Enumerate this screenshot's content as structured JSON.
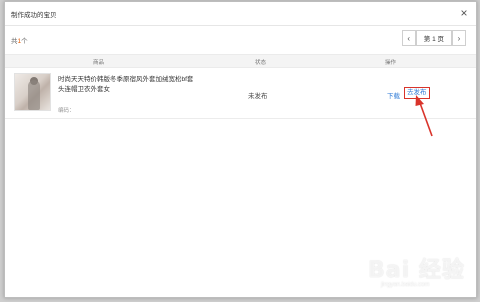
{
  "dialog": {
    "title": "制作成功的宝贝",
    "close_glyph": "×"
  },
  "summary": {
    "prefix": "共",
    "count": "1",
    "suffix": "个"
  },
  "pager": {
    "prev": "‹",
    "page_label": "第 1 页",
    "next": "›"
  },
  "table": {
    "columns": [
      "商品",
      "状态",
      "操作"
    ],
    "rows": [
      {
        "title": "时尚天天特价韩版冬季原宿风外套加绒宽松bf套头连帽卫衣外套女",
        "code_label": "编码：",
        "status": "未发布",
        "action_download": "下载",
        "action_publish": "去发布"
      }
    ]
  },
  "watermark": {
    "text": "Bai 经验",
    "sub": "jingyan.baidu.com"
  },
  "colors": {
    "accent_orange": "#e85b00",
    "link_blue": "#2d7ad6",
    "highlight_red": "#d9342b"
  }
}
